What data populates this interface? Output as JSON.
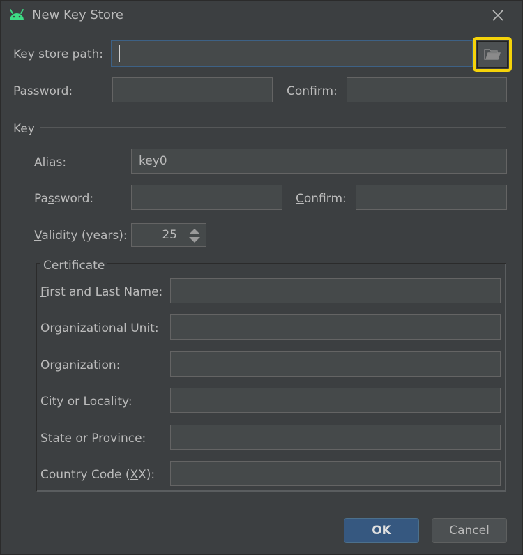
{
  "window": {
    "title": "New Key Store",
    "app_icon": "android-icon",
    "close_icon": "close-icon"
  },
  "keystore": {
    "path_label": "Key store path:",
    "path_value": "",
    "browse_icon": "folder-open-icon",
    "password_label": "Password:",
    "password_value": "",
    "confirm_label": "Confirm:",
    "confirm_value": ""
  },
  "key": {
    "section_label": "Key",
    "alias_label": "Alias:",
    "alias_value": "key0",
    "password_label": "Password:",
    "password_value": "",
    "confirm_label": "Confirm:",
    "confirm_value": "",
    "validity_label": "Validity (years):",
    "validity_value": "25"
  },
  "certificate": {
    "title": "Certificate",
    "fields": [
      {
        "label": "First and Last Name:",
        "value": ""
      },
      {
        "label": "Organizational Unit:",
        "value": ""
      },
      {
        "label": "Organization:",
        "value": ""
      },
      {
        "label": "City or Locality:",
        "value": ""
      },
      {
        "label": "State or Province:",
        "value": ""
      },
      {
        "label": "Country Code (XX):",
        "value": ""
      }
    ]
  },
  "buttons": {
    "ok": "OK",
    "cancel": "Cancel"
  },
  "colors": {
    "background": "#3c3f41",
    "field": "#45494a",
    "focus": "#3d6185",
    "highlight": "#f5d30a",
    "primary_button": "#365880",
    "android_green": "#3ddc84"
  }
}
